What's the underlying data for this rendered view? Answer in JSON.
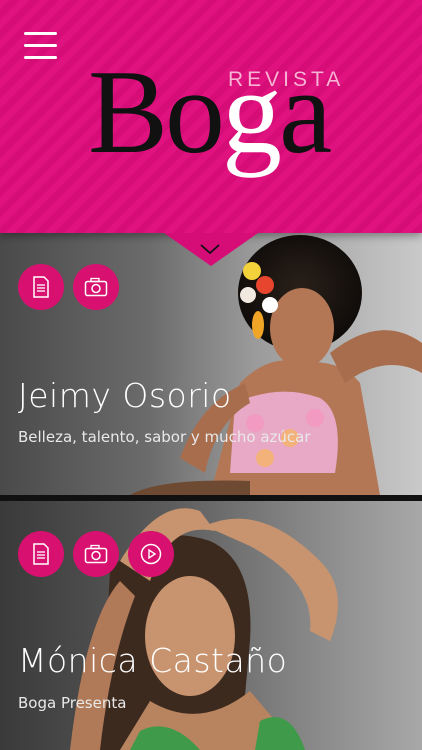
{
  "header": {
    "logo_small": "REVISTA",
    "logo_main_a": "Bo",
    "logo_main_g": "g",
    "logo_main_b": "a",
    "brand_color": "#e0127f"
  },
  "cards": [
    {
      "name": "Jeimy Osorio",
      "subtitle": "Belleza, talento, sabor y mucho azúcar",
      "icons": [
        "document-icon",
        "camera-icon"
      ]
    },
    {
      "name": "Mónica Castaño",
      "subtitle": "Boga Presenta",
      "icons": [
        "document-icon",
        "camera-icon",
        "play-icon"
      ]
    }
  ]
}
